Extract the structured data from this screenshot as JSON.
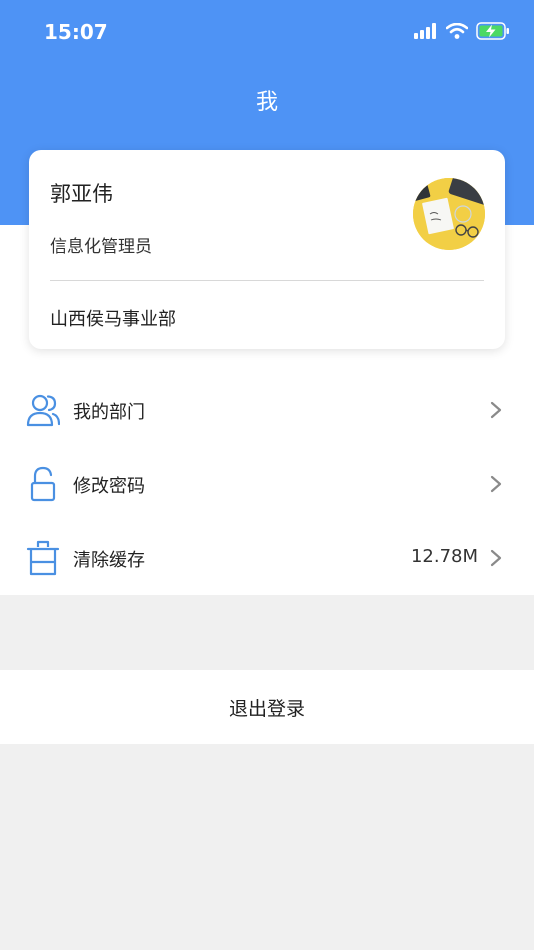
{
  "status_bar": {
    "time": "15:07"
  },
  "header": {
    "title": "我"
  },
  "profile": {
    "name": "郭亚伟",
    "role": "信息化管理员",
    "department": "山西侯马事业部"
  },
  "menu": {
    "items": [
      {
        "label": "我的部门",
        "icon": "users-icon"
      },
      {
        "label": "修改密码",
        "icon": "lock-open-icon"
      },
      {
        "label": "清除缓存",
        "icon": "trash-icon",
        "value": "12.78M"
      }
    ]
  },
  "logout": {
    "label": "退出登录"
  },
  "colors": {
    "accent": "#4e93f5",
    "icon_blue": "#4a90e2",
    "background": "#f0f0f0"
  }
}
